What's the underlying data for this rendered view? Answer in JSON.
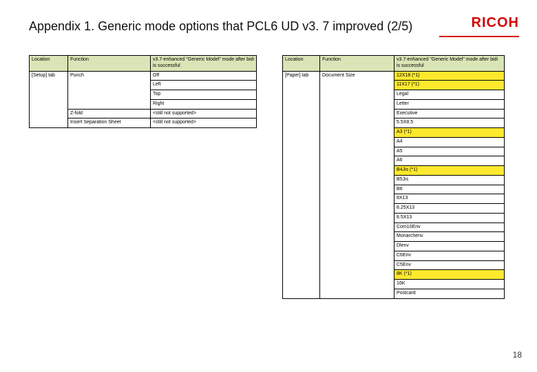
{
  "title": "Appendix 1. Generic mode options that PCL6 UD v3. 7 improved (2/5)",
  "logo": "RICOH",
  "page_number": "18",
  "left_table": {
    "headers": {
      "location": "Location",
      "function": "Function",
      "mode": "v3.7-enhanced \"Generic Model\" mode after bidi is successful"
    },
    "rows": [
      {
        "location": "[Setup] tab",
        "function": "Punch",
        "mode": "Off"
      },
      {
        "mode": "Left"
      },
      {
        "mode": "Top"
      },
      {
        "mode": "Right"
      },
      {
        "function": "Z-fold",
        "mode": "<still not supported>"
      },
      {
        "function": "Insert Separation Sheet",
        "mode": "<still not supported>"
      }
    ]
  },
  "right_table": {
    "headers": {
      "location": "Location",
      "function": "Function",
      "mode": "v3.7-enhanced \"Generic Model\" mode after bidi is successful"
    },
    "location": "[Paper] tab",
    "function": "Document Size",
    "modes": [
      {
        "v": "12X18 (*1)",
        "hl": true
      },
      {
        "v": "11X17 (*1)",
        "hl": true
      },
      {
        "v": "Legal"
      },
      {
        "v": "Letter"
      },
      {
        "v": "Executive"
      },
      {
        "v": "5.5X8.5"
      },
      {
        "v": "A3 (*1)",
        "hl": true
      },
      {
        "v": "A4"
      },
      {
        "v": "A5"
      },
      {
        "v": "A6"
      },
      {
        "v": "B4Jis (*1)",
        "hl": true
      },
      {
        "v": "B5Jis"
      },
      {
        "v": "B6"
      },
      {
        "v": "8X13"
      },
      {
        "v": "8.25X13"
      },
      {
        "v": "8.5X13"
      },
      {
        "v": "Com10Env"
      },
      {
        "v": "Monarchenv"
      },
      {
        "v": "Dlenv"
      },
      {
        "v": "C6Env"
      },
      {
        "v": "C5Env"
      },
      {
        "v": "8K (*1)",
        "hl": true
      },
      {
        "v": "16K"
      },
      {
        "v": "Postcard"
      }
    ]
  }
}
